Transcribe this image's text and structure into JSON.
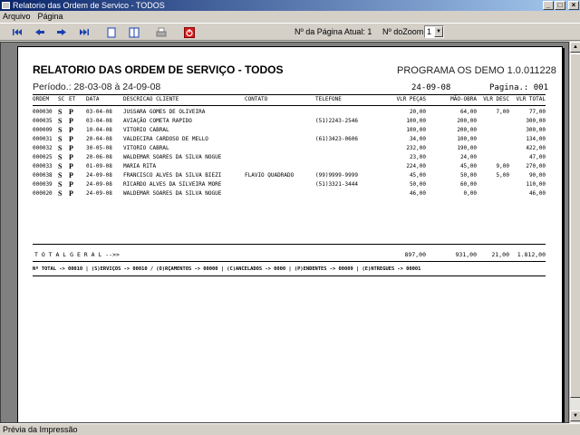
{
  "window": {
    "title": "Relatorio das Ordem de Servico - TODOS"
  },
  "menu": {
    "items": [
      "Arquivo",
      "Página"
    ]
  },
  "toolbar": {
    "page_label": "Nº da Página Atual: 1",
    "zoom_label": "Nº doZoom",
    "zoom_value": "1"
  },
  "report": {
    "title": "RELATORIO DAS ORDEM DE SERVIÇO  - TODOS",
    "program": "PROGRAMA OS DEMO 1.0.011228",
    "period": "Período.: 28-03-08 à 24-09-08",
    "date": "24-09-08",
    "page": "Pagina.: 001",
    "columns": {
      "ordem": "ORDEM",
      "sc": "SC",
      "et": "ET",
      "data": "DATA",
      "cliente": "DESCRICAO CLIENTE",
      "contato": "CONTATO",
      "telefone": "TELEFONE",
      "pecas": "VLR PEÇAS",
      "mao": "MÃO-OBRA",
      "desc": "VLR DESC",
      "total": "VLR TOTAL"
    },
    "rows": [
      {
        "ordem": "000030",
        "sc": "S",
        "et": "P",
        "data": "03-04-08",
        "cliente": "JUSSARA GOMES DE OLIVEIRA",
        "contato": "",
        "telefone": "",
        "pecas": "20,00",
        "mao": "64,00",
        "desc": "7,00",
        "total": "77,00"
      },
      {
        "ordem": "000035",
        "sc": "S",
        "et": "P",
        "data": "03-04-08",
        "cliente": "AVIAÇÃO COMETA RAPIDO",
        "contato": "",
        "telefone": "(51)2243-2546",
        "pecas": "100,00",
        "mao": "200,00",
        "desc": "",
        "total": "300,00"
      },
      {
        "ordem": "000009",
        "sc": "S",
        "et": "P",
        "data": "10-04-08",
        "cliente": "VITORIO CABRAL",
        "contato": "",
        "telefone": "",
        "pecas": "100,00",
        "mao": "200,00",
        "desc": "",
        "total": "300,00"
      },
      {
        "ordem": "000031",
        "sc": "S",
        "et": "P",
        "data": "20-04-08",
        "cliente": "VALDECIRA CARDOSO DE MELLO",
        "contato": "",
        "telefone": "(61)3423-0606",
        "pecas": "34,00",
        "mao": "100,00",
        "desc": "",
        "total": "134,00"
      },
      {
        "ordem": "000032",
        "sc": "S",
        "et": "P",
        "data": "30-05-08",
        "cliente": "VITORIO CABRAL",
        "contato": "",
        "telefone": "",
        "pecas": "232,00",
        "mao": "190,00",
        "desc": "",
        "total": "422,00"
      },
      {
        "ordem": "000025",
        "sc": "S",
        "et": "P",
        "data": "20-06-08",
        "cliente": "WALDEMAR SOARES DA SILVA NOGUE",
        "contato": "",
        "telefone": "",
        "pecas": "23,00",
        "mao": "24,00",
        "desc": "",
        "total": "47,00"
      },
      {
        "ordem": "000033",
        "sc": "S",
        "et": "P",
        "data": "01-09-08",
        "cliente": "MARIA RITA",
        "contato": "",
        "telefone": "",
        "pecas": "224,00",
        "mao": "45,00",
        "desc": "9,00",
        "total": "270,00"
      },
      {
        "ordem": "000038",
        "sc": "S",
        "et": "P",
        "data": "24-09-08",
        "cliente": "FRANCISCO ALVES DA SILVA BIEZI",
        "contato": "FLAVIO QUADRADO",
        "telefone": "(99)9999-9999",
        "pecas": "45,00",
        "mao": "50,00",
        "desc": "5,00",
        "total": "90,00"
      },
      {
        "ordem": "000039",
        "sc": "S",
        "et": "P",
        "data": "24-09-08",
        "cliente": "RICARDO ALVES DA SILVEIRA MORE",
        "contato": "",
        "telefone": "(51)3321-3444",
        "pecas": "50,00",
        "mao": "60,00",
        "desc": "",
        "total": "110,00"
      },
      {
        "ordem": "000020",
        "sc": "S",
        "et": "P",
        "data": "24-09-08",
        "cliente": "WALDEMAR SOARES DA SILVA NOGUE",
        "contato": "",
        "telefone": "",
        "pecas": "46,00",
        "mao": "0,00",
        "desc": "",
        "total": "46,00"
      }
    ],
    "totals": {
      "label": "T O T A L   G E R A L   -->>",
      "pecas": "897,00",
      "mao": "931,00",
      "desc": "21,00",
      "total": "1.812,00"
    },
    "legend": "Nº TOTAL -> 00010 | (S)ERVIÇOS -> 00010 / (O)RÇAMENTOS -> 00000 | (C)ANCELADOS -> 0000 | (P)ENDENTES -> 00009 | (E)NTREGUES -> 00001"
  },
  "status": {
    "text": "Prévia da Impressão"
  }
}
